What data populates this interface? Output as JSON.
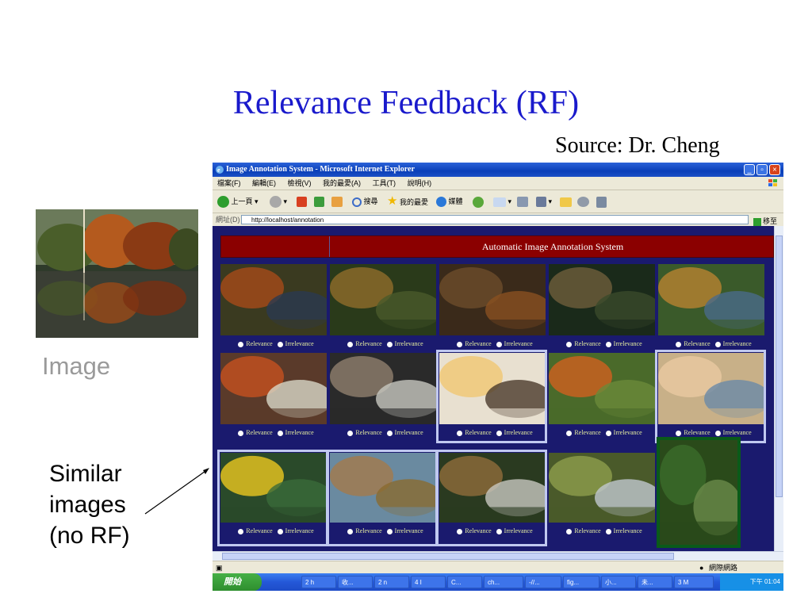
{
  "slide": {
    "title": "Relevance Feedback (RF)",
    "source": "Source: Dr. Cheng",
    "query_label": "Image",
    "similar_label_lines": [
      "Similar",
      "images",
      "(no RF)"
    ]
  },
  "browser": {
    "window_title": "Image Annotation System - Microsoft Internet Explorer",
    "menu": [
      "檔案(F)",
      "編輯(E)",
      "檢視(V)",
      "我的最愛(A)",
      "工具(T)",
      "說明(H)"
    ],
    "toolbar": {
      "back": "上一頁",
      "search": "搜尋",
      "favorites": "我的最愛",
      "media": "媒體"
    },
    "address_label": "網址(D)",
    "address": "http://localhost/annotation",
    "go": "移至",
    "status_zone": "網際網路",
    "taskbar": {
      "start": "開始",
      "tasks": [
        "2 h",
        "收...",
        "2 n",
        "4 I",
        "C...",
        "ch...",
        "-//...",
        "fig...",
        "小...",
        "未...",
        "3 M"
      ],
      "clock": "下午 01:04"
    }
  },
  "app": {
    "header": "Automatic Image Annotation System",
    "option_relevance": "Relevance",
    "option_irrelevance": "Irrelevance"
  },
  "colors": {
    "title_blue": "#1a1acc",
    "page_bg": "#1a1a6e",
    "header_band": "#8b0000",
    "highlight": "#c0c8f0"
  }
}
